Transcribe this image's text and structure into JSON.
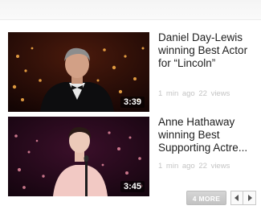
{
  "videos": [
    {
      "title": "Daniel Day-Lewis winning Best Actor for “Lincoln”",
      "duration": "3:39",
      "meta": "1 min ago   22 views"
    },
    {
      "title": "Anne Hathaway winning Best Supporting Actre...",
      "duration": "3:45",
      "meta": "1 min ago   22 views"
    }
  ],
  "controls": {
    "more_label": "4 MORE",
    "prev_icon": "left-arrow-icon",
    "next_icon": "right-arrow-icon"
  },
  "colors": {
    "title_text": "#1e1e1e",
    "meta_text": "#c4c4c4",
    "more_button_bg": "#cccccc"
  }
}
